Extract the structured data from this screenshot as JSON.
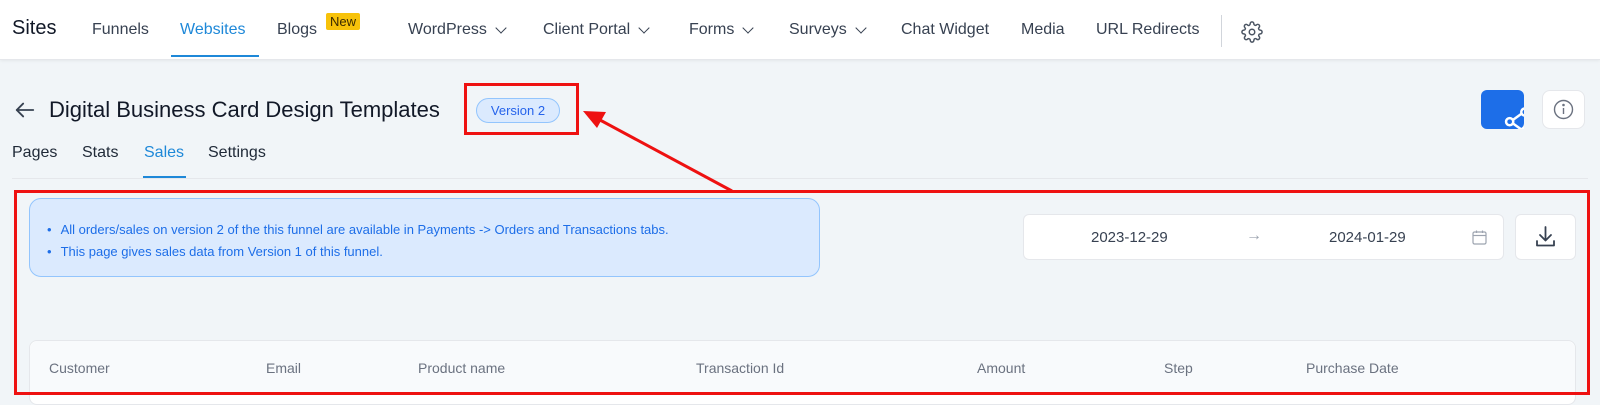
{
  "topnav": {
    "brand": "Sites",
    "items": [
      {
        "label": "Funnels"
      },
      {
        "label": "Websites"
      },
      {
        "label": "Blogs"
      },
      {
        "label": "WordPress"
      },
      {
        "label": "Client Portal"
      },
      {
        "label": "Forms"
      },
      {
        "label": "Surveys"
      },
      {
        "label": "Chat Widget"
      },
      {
        "label": "Media"
      },
      {
        "label": "URL Redirects"
      }
    ],
    "active_item": "Websites",
    "new_badge": "New",
    "settings_icon": "gear-icon"
  },
  "header": {
    "title": "Digital Business Card Design Templates",
    "version": "Version 2",
    "share_icon": "share-icon",
    "info_icon": "info-icon"
  },
  "tabs": [
    {
      "label": "Pages"
    },
    {
      "label": "Stats"
    },
    {
      "label": "Sales"
    },
    {
      "label": "Settings"
    }
  ],
  "active_tab": "Sales",
  "notice": {
    "items": [
      "All orders/sales on version 2 of the this funnel are available in Payments -> Orders and Transactions tabs.",
      "This page gives sales data from Version 1 of this funnel."
    ]
  },
  "date_range": {
    "start": "2023-12-29",
    "separator": "→",
    "end": "2024-01-29"
  },
  "table": {
    "columns": [
      "Customer",
      "Email",
      "Product name",
      "Transaction Id",
      "Amount",
      "Step",
      "Purchase Date"
    ]
  },
  "colors": {
    "accent": "#1e88d8",
    "primary_button": "#1d6ee8",
    "annotation": "#ee1111",
    "new_badge": "#f7c20a"
  }
}
